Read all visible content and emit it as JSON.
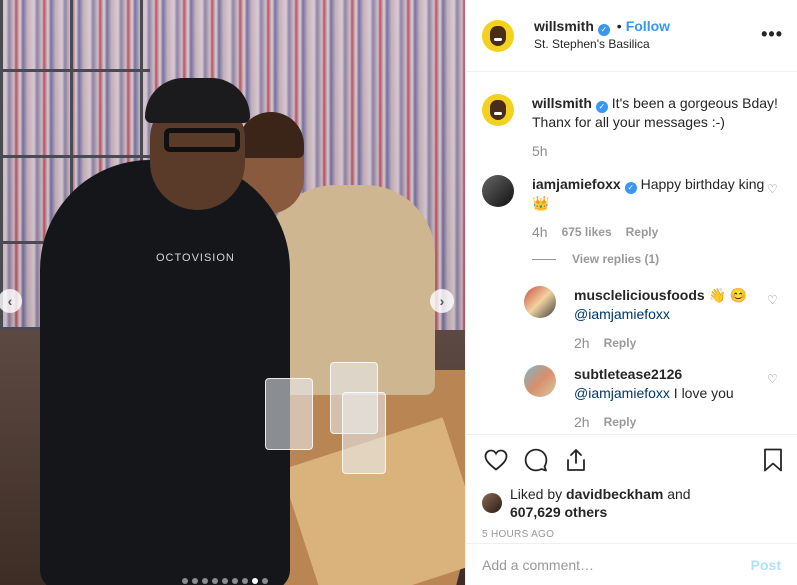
{
  "post": {
    "username": "willsmith",
    "follow_label": "Follow",
    "separator": "•",
    "location": "St. Stephen's Basilica",
    "more_label": "•••",
    "caption": "It's been a gorgeous Bday! Thanx for all your messages :-)",
    "caption_time": "5h",
    "photo_shirt_text": "OCTOVISION"
  },
  "comments": [
    {
      "username": "iamjamiefoxx",
      "text": "Happy birthday king 👑",
      "time": "4h",
      "likes": "675 likes",
      "reply_label": "Reply",
      "view_replies": "View replies (1)"
    }
  ],
  "replies": [
    {
      "username": "musclelicousfoods",
      "display_username": "muscleliciousfoods",
      "emoji": "👋 😊",
      "mention": "@iamjamiefoxx",
      "text": "",
      "time": "2h",
      "reply_label": "Reply"
    },
    {
      "username": "subtletease2126",
      "mention": "@iamjamiefoxx",
      "text": " I love you",
      "time": "2h",
      "reply_label": "Reply"
    }
  ],
  "liked": {
    "prefix": "Liked by ",
    "user": "davidbeckham",
    "middle": " and",
    "count": "607,629 others"
  },
  "time_ago": "5 HOURS AGO",
  "comment_input": {
    "placeholder": "Add a comment…",
    "post_label": "Post"
  },
  "carousel": {
    "prev": "‹",
    "next": "›"
  },
  "icon_names": [
    "heart-icon",
    "comment-icon",
    "share-icon",
    "bookmark-icon"
  ]
}
